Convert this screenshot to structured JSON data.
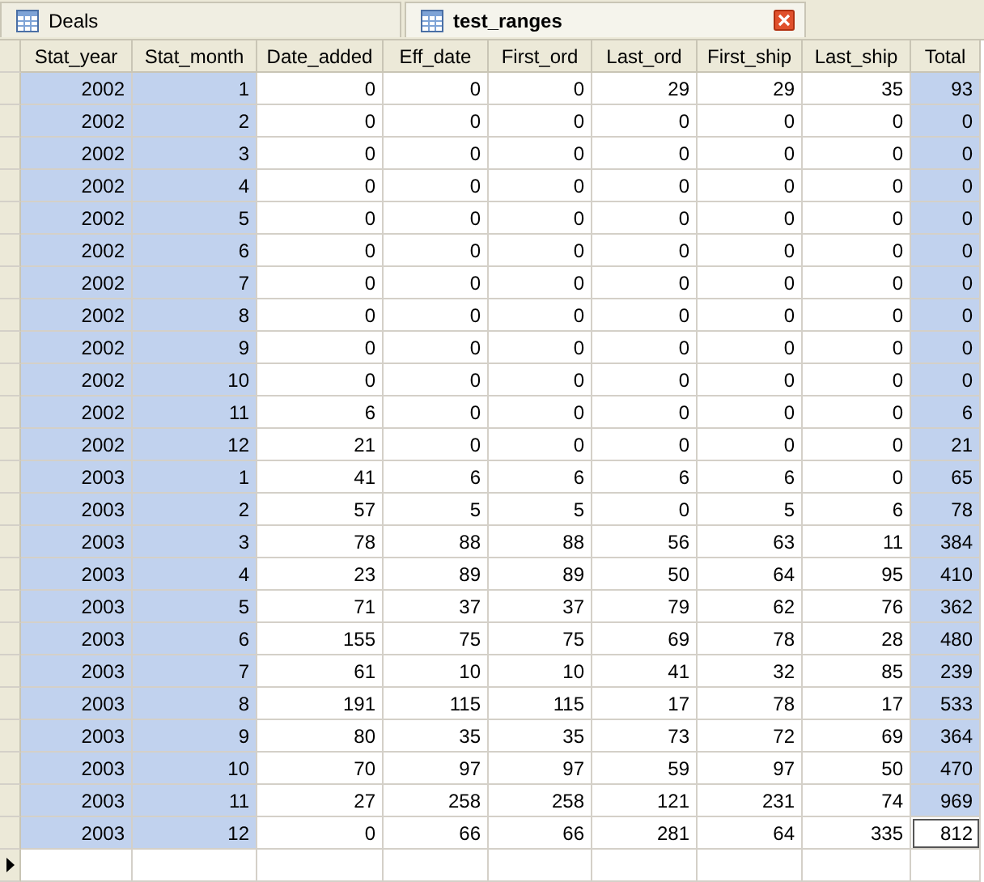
{
  "tabs": [
    {
      "label": "Deals",
      "selected": false,
      "closable": false
    },
    {
      "label": "test_ranges",
      "selected": true,
      "closable": true
    }
  ],
  "table": {
    "columns": [
      {
        "label": "Stat_year",
        "selected": true
      },
      {
        "label": "Stat_month",
        "selected": true
      },
      {
        "label": "Date_added",
        "selected": false
      },
      {
        "label": "Eff_date",
        "selected": false
      },
      {
        "label": "First_ord",
        "selected": false
      },
      {
        "label": "Last_ord",
        "selected": false
      },
      {
        "label": "First_ship",
        "selected": false
      },
      {
        "label": "Last_ship",
        "selected": false
      },
      {
        "label": "Total",
        "selected": true
      }
    ],
    "rows": [
      {
        "cells": [
          "2002",
          "1",
          "0",
          "0",
          "0",
          "29",
          "29",
          "35",
          "93"
        ],
        "focused": false
      },
      {
        "cells": [
          "2002",
          "2",
          "0",
          "0",
          "0",
          "0",
          "0",
          "0",
          "0"
        ],
        "focused": false
      },
      {
        "cells": [
          "2002",
          "3",
          "0",
          "0",
          "0",
          "0",
          "0",
          "0",
          "0"
        ],
        "focused": false
      },
      {
        "cells": [
          "2002",
          "4",
          "0",
          "0",
          "0",
          "0",
          "0",
          "0",
          "0"
        ],
        "focused": false
      },
      {
        "cells": [
          "2002",
          "5",
          "0",
          "0",
          "0",
          "0",
          "0",
          "0",
          "0"
        ],
        "focused": false
      },
      {
        "cells": [
          "2002",
          "6",
          "0",
          "0",
          "0",
          "0",
          "0",
          "0",
          "0"
        ],
        "focused": false
      },
      {
        "cells": [
          "2002",
          "7",
          "0",
          "0",
          "0",
          "0",
          "0",
          "0",
          "0"
        ],
        "focused": false
      },
      {
        "cells": [
          "2002",
          "8",
          "0",
          "0",
          "0",
          "0",
          "0",
          "0",
          "0"
        ],
        "focused": false
      },
      {
        "cells": [
          "2002",
          "9",
          "0",
          "0",
          "0",
          "0",
          "0",
          "0",
          "0"
        ],
        "focused": false
      },
      {
        "cells": [
          "2002",
          "10",
          "0",
          "0",
          "0",
          "0",
          "0",
          "0",
          "0"
        ],
        "focused": false
      },
      {
        "cells": [
          "2002",
          "11",
          "6",
          "0",
          "0",
          "0",
          "0",
          "0",
          "6"
        ],
        "focused": false
      },
      {
        "cells": [
          "2002",
          "12",
          "21",
          "0",
          "0",
          "0",
          "0",
          "0",
          "21"
        ],
        "focused": false
      },
      {
        "cells": [
          "2003",
          "1",
          "41",
          "6",
          "6",
          "6",
          "6",
          "0",
          "65"
        ],
        "focused": false
      },
      {
        "cells": [
          "2003",
          "2",
          "57",
          "5",
          "5",
          "0",
          "5",
          "6",
          "78"
        ],
        "focused": false
      },
      {
        "cells": [
          "2003",
          "3",
          "78",
          "88",
          "88",
          "56",
          "63",
          "11",
          "384"
        ],
        "focused": false
      },
      {
        "cells": [
          "2003",
          "4",
          "23",
          "89",
          "89",
          "50",
          "64",
          "95",
          "410"
        ],
        "focused": false
      },
      {
        "cells": [
          "2003",
          "5",
          "71",
          "37",
          "37",
          "79",
          "62",
          "76",
          "362"
        ],
        "focused": false
      },
      {
        "cells": [
          "2003",
          "6",
          "155",
          "75",
          "75",
          "69",
          "78",
          "28",
          "480"
        ],
        "focused": false
      },
      {
        "cells": [
          "2003",
          "7",
          "61",
          "10",
          "10",
          "41",
          "32",
          "85",
          "239"
        ],
        "focused": false
      },
      {
        "cells": [
          "2003",
          "8",
          "191",
          "115",
          "115",
          "17",
          "78",
          "17",
          "533"
        ],
        "focused": false
      },
      {
        "cells": [
          "2003",
          "9",
          "80",
          "35",
          "35",
          "73",
          "72",
          "69",
          "364"
        ],
        "focused": false
      },
      {
        "cells": [
          "2003",
          "10",
          "70",
          "97",
          "97",
          "59",
          "97",
          "50",
          "470"
        ],
        "focused": false
      },
      {
        "cells": [
          "2003",
          "11",
          "27",
          "258",
          "258",
          "121",
          "231",
          "74",
          "969"
        ],
        "focused": false
      },
      {
        "cells": [
          "2003",
          "12",
          "0",
          "66",
          "66",
          "281",
          "64",
          "335",
          "812"
        ],
        "focused": true
      }
    ],
    "new_row": {
      "current": true
    }
  }
}
